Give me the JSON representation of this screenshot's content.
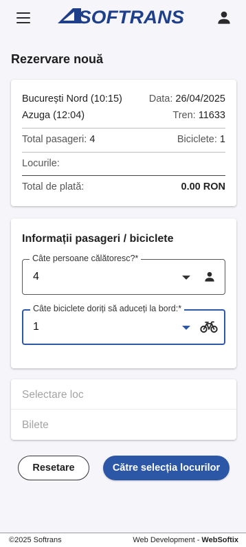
{
  "header": {
    "logo_text": "SOFTRANS",
    "menu_icon": "menu-icon",
    "account_icon": "account-icon"
  },
  "page": {
    "title": "Rezervare nouă"
  },
  "summary": {
    "departure": "București Nord (10:15)",
    "date_label": "Data:",
    "date_value": "26/04/2025",
    "arrival": "Azuga (12:04)",
    "train_label": "Tren:",
    "train_value": "11633",
    "passengers_label": "Total pasageri:",
    "passengers_value": "4",
    "bikes_label": "Biciclete:",
    "bikes_value": "1",
    "seats_label": "Locurile:",
    "total_label": "Total de plată:",
    "total_value": "0.00 RON"
  },
  "info": {
    "title": "Informații pasageri / biciclete",
    "persons_label": "Câte persoane călătoresc?*",
    "persons_value": "4",
    "bikes_label": "Câte biciclete doriți să aduceți la bord:*",
    "bikes_value": "1"
  },
  "accordion": {
    "seat_selection": "Selectare loc",
    "tickets": "Bilete"
  },
  "actions": {
    "reset": "Resetare",
    "next": "Către selecția locurilor"
  },
  "footer": {
    "copyright": "©2025 Softrans",
    "credit_prefix": "Web Development - ",
    "credit_name": "WebSoftix"
  },
  "colors": {
    "primary": "#2c57a6",
    "logo": "#1e3f8a",
    "background": "#f6f5fa"
  }
}
